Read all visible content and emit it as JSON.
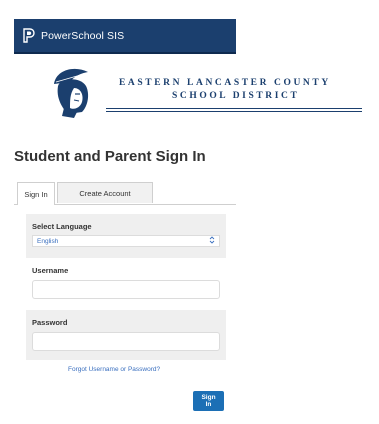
{
  "header": {
    "brand": "PowerSchool SIS"
  },
  "district": {
    "line1": "EASTERN LANCASTER COUNTY",
    "line2": "SCHOOL DISTRICT"
  },
  "page": {
    "title": "Student and Parent Sign In"
  },
  "tabs": [
    {
      "label": "Sign In",
      "active": true
    },
    {
      "label": "Create Account",
      "active": false
    }
  ],
  "form": {
    "language_label": "Select Language",
    "language_value": "English",
    "username_label": "Username",
    "username_value": "",
    "password_label": "Password",
    "password_value": "",
    "forgot_link": "Forgot Username or Password?",
    "submit_label": "Sign In"
  },
  "colors": {
    "header_bg": "#1b3f6e",
    "accent": "#1c6fb5",
    "link": "#3a6fbf"
  },
  "icons": {
    "brand_logo": "powerschool-logo-icon",
    "district_logo": "spartan-mascot-icon",
    "select_caret": "updown-chevron-icon"
  }
}
